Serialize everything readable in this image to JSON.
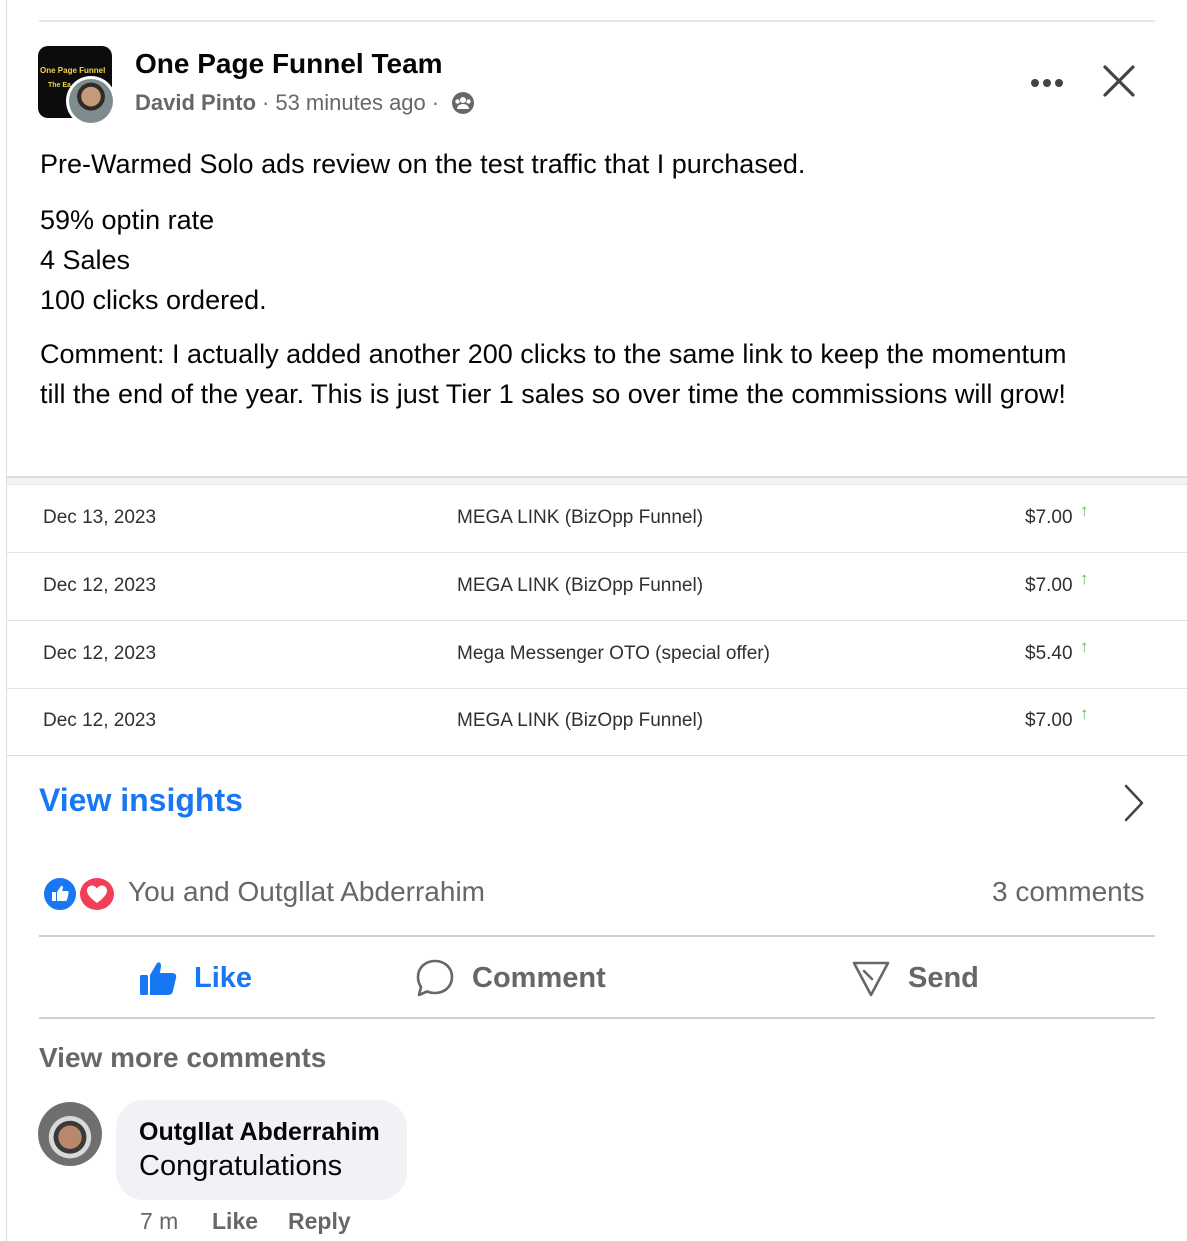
{
  "post": {
    "group_name": "One Page Funnel Team",
    "author": "David Pinto",
    "separator": "·",
    "time": "53 minutes ago",
    "audience_icon": "group-audience-icon",
    "group_avatar_text_1": "One Page Funnel",
    "group_avatar_text_2": "The Ea",
    "text_intro": "Pre-Warmed Solo ads review on the test traffic that I purchased.",
    "stats": [
      "59% optin rate",
      "4 Sales",
      "100 clicks ordered."
    ],
    "comment_paragraph": "Comment: I actually added another 200 clicks to the same link to keep the momentum till the end of the year. This is just Tier 1 sales so over time the commissions will grow!"
  },
  "sales_table": {
    "columns": [
      "date",
      "product",
      "amount"
    ],
    "arrow": "↑",
    "rows": [
      {
        "date": "Dec 13, 2023",
        "product": "MEGA LINK (BizOpp Funnel)",
        "amount": "$7.00"
      },
      {
        "date": "Dec 12, 2023",
        "product": "MEGA LINK (BizOpp Funnel)",
        "amount": "$7.00"
      },
      {
        "date": "Dec 12, 2023",
        "product": "Mega Messenger OTO (special offer)",
        "amount": "$5.40"
      },
      {
        "date": "Dec 12, 2023",
        "product": "MEGA LINK (BizOpp Funnel)",
        "amount": "$7.00"
      }
    ]
  },
  "insights": {
    "label": "View insights"
  },
  "reactions": {
    "types": [
      "like",
      "love"
    ],
    "names": "You and Outgllat Abderrahim",
    "comment_count": "3 comments"
  },
  "actions": {
    "like": "Like",
    "comment": "Comment",
    "send": "Send"
  },
  "comments": {
    "view_more": "View more comments",
    "items": [
      {
        "author": "Outgllat Abderrahim",
        "text": "Congratulations",
        "time": "7 m",
        "like": "Like",
        "reply": "Reply"
      }
    ]
  },
  "colors": {
    "accent": "#1877f2",
    "secondary_text": "#65676b",
    "love": "#f33e58",
    "bubble": "#f0f2f5",
    "up_arrow": "#5cb85c"
  }
}
